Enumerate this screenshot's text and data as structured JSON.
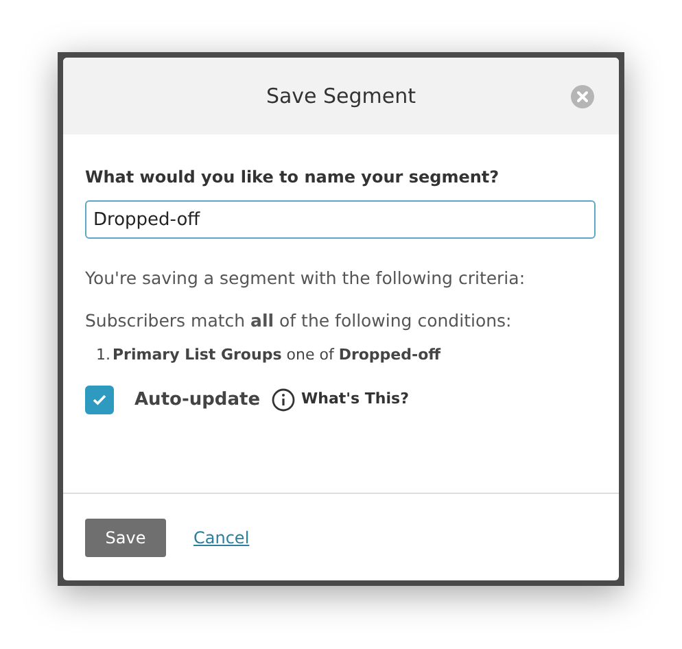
{
  "dialog": {
    "title": "Save Segment"
  },
  "name_field": {
    "label": "What would you like to name your segment?",
    "value": "Dropped-off"
  },
  "criteria_intro": "You're saving a segment with the following criteria:",
  "match_text": "Subscribers match **all** of the following conditions:",
  "conditions": [
    {
      "number": "1.",
      "text": "**Primary List Groups** one of **Dropped-off**"
    }
  ],
  "auto_update": {
    "label": "Auto-update",
    "checked": true,
    "help_link": "What's This?"
  },
  "buttons": {
    "save": "Save",
    "cancel": "Cancel"
  }
}
